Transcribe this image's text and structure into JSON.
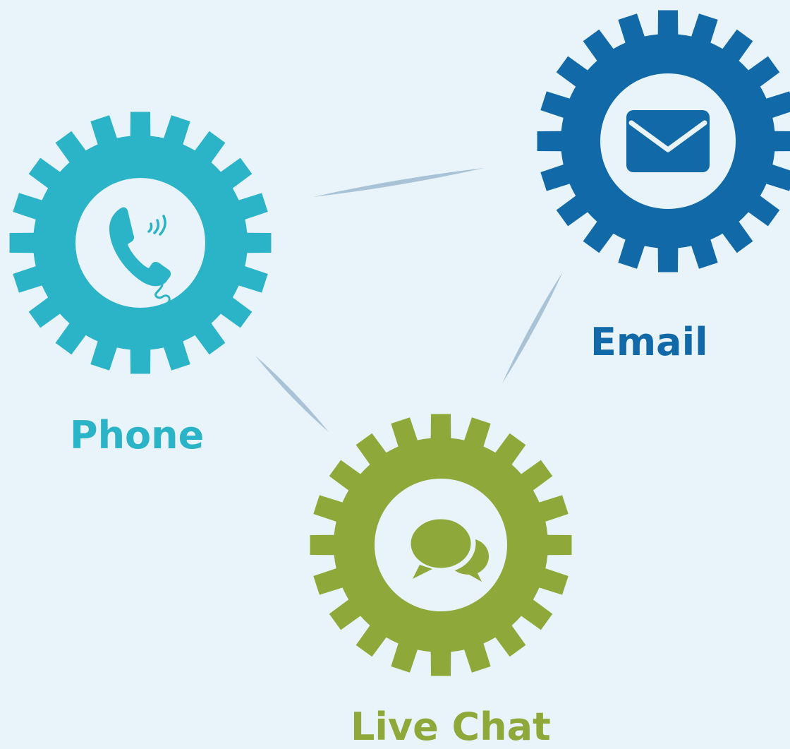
{
  "nodes": {
    "phone": {
      "label": "Phone",
      "color": "#2bb3c8",
      "icon": "phone-icon"
    },
    "email": {
      "label": "Email",
      "color": "#1269a8",
      "icon": "envelope-icon"
    },
    "chat": {
      "label": "Live Chat",
      "color": "#8ea93a",
      "icon": "chat-bubbles-icon"
    }
  },
  "links": [
    {
      "from": "phone",
      "to": "email"
    },
    {
      "from": "email",
      "to": "chat"
    },
    {
      "from": "phone",
      "to": "chat"
    }
  ],
  "colors": {
    "background": "#e8f3fa",
    "link": "#a9c2d6",
    "gear_inner": "#e8f3fa"
  }
}
